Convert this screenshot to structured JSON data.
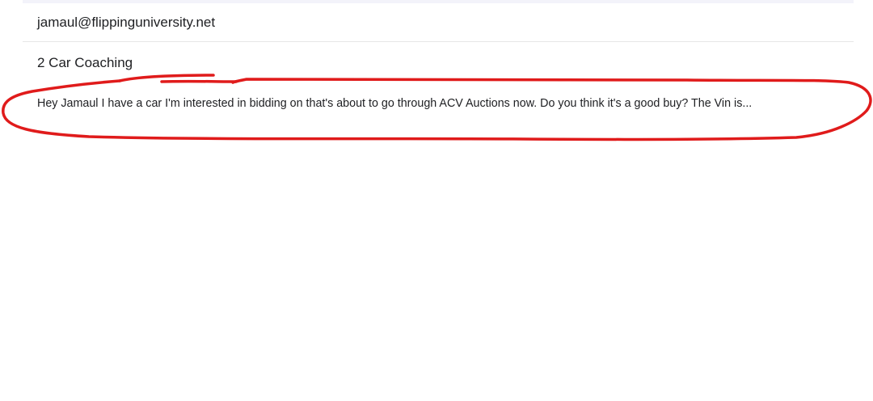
{
  "email": {
    "from_address": "jamaul@flippinguniversity.net",
    "subject": "2 Car Coaching",
    "body_preview": "Hey Jamaul I have a car I'm interested in bidding on that's about to go through ACV Auctions now. Do you think it's a good buy? The Vin is..."
  },
  "colors": {
    "annotation": "#e01b1b",
    "text": "#202124",
    "divider": "#e6e6e6",
    "top_bar": "#f3f3fa"
  }
}
